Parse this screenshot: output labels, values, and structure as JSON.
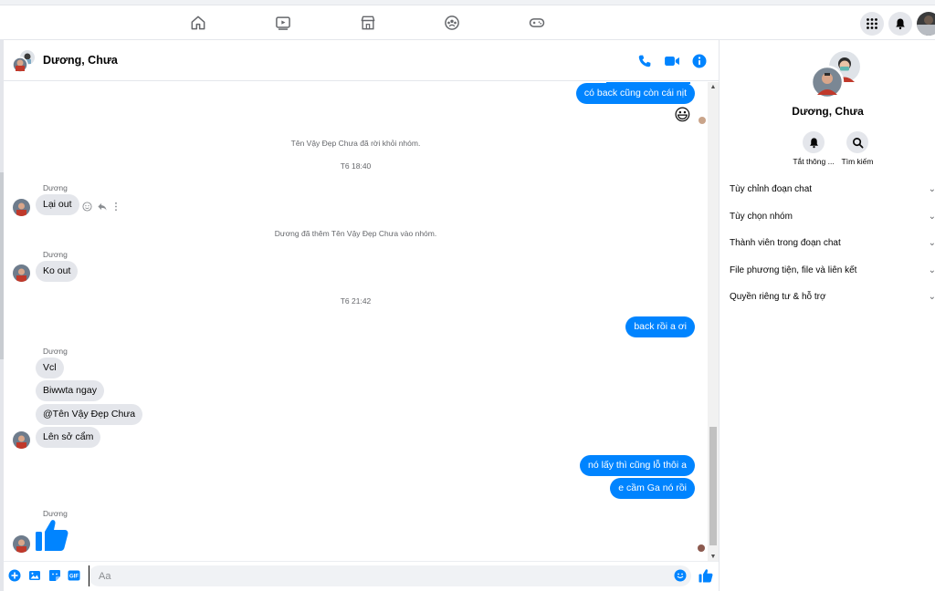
{
  "header": {
    "title": "Dương, Chưa"
  },
  "messages": {
    "outgoing_top": "có back cũng còn cái nịt",
    "emoji_reaction": "😃",
    "system_left": "Tên Vậy Đẹp Chưa đã rời khỏi nhóm.",
    "time_1": "T6 18:40",
    "sender_1": "Dương",
    "msg_1": "Lại out",
    "system_added": "Dương đã thêm Tên Vậy Đẹp Chưa vào nhóm.",
    "sender_2": "Dương",
    "msg_2": "Ko out",
    "time_2": "T6 21:42",
    "outgoing_2": "back rồi a ơi",
    "sender_3": "Dương",
    "msg_3a": "Vcl",
    "msg_3b": "Biwwta ngay",
    "msg_3c": "@Tên Vậy Đẹp Chưa",
    "msg_3d": "Lên sở cẩm",
    "outgoing_3a": "nó lấy thì cũng lỗ thôi a",
    "outgoing_3b": "e cầm Ga nó rồi",
    "sender_4": "Dương"
  },
  "composer": {
    "placeholder": "Aa"
  },
  "right_panel": {
    "name": "Dương, Chưa",
    "actions": [
      {
        "label": "Tắt thông ...",
        "icon": "bell-icon"
      },
      {
        "label": "Tìm kiếm",
        "icon": "search-icon"
      }
    ],
    "sections": [
      "Tùy chỉnh đoạn chat",
      "Tùy chọn nhóm",
      "Thành viên trong đoạn chat",
      "File phương tiện, file và liên kết",
      "Quyền riêng tư & hỗ trợ"
    ]
  },
  "colors": {
    "accent": "#0084ff",
    "incoming_bubble": "#e4e6eb",
    "secondary_text": "#65676b"
  }
}
